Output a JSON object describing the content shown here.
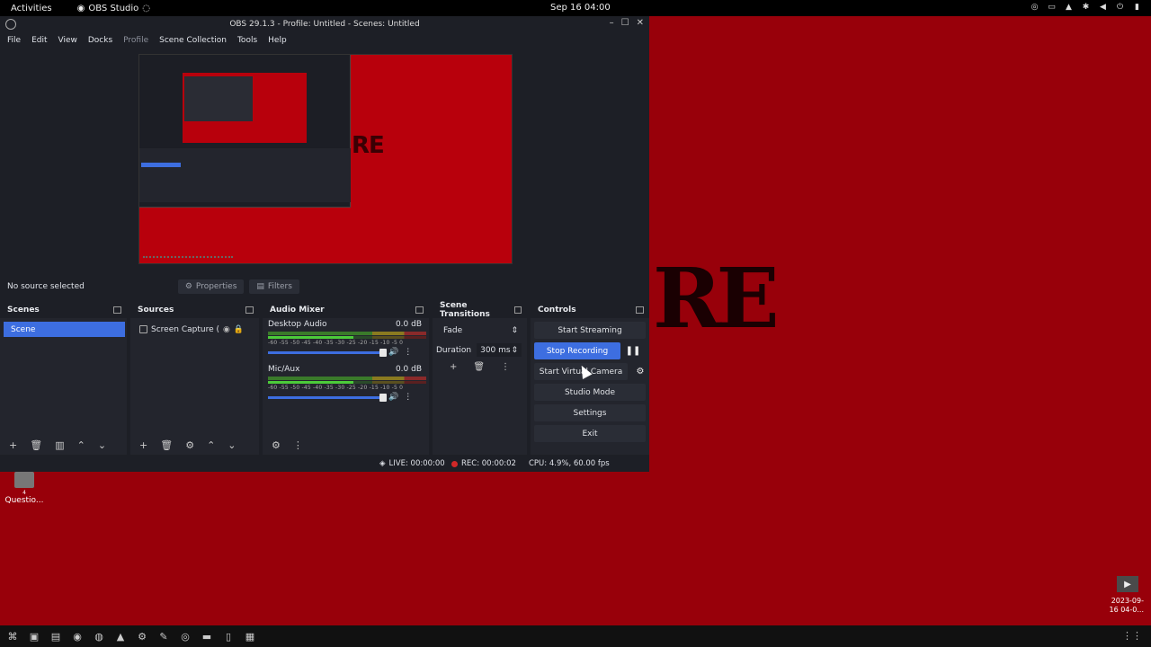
{
  "topbar": {
    "activities": "Activities",
    "app_name": "OBS Studio",
    "clock": "Sep 16  04:00"
  },
  "window": {
    "title": "OBS 29.1.3 - Profile: Untitled - Scenes: Untitled"
  },
  "menu": {
    "file": "File",
    "edit": "Edit",
    "view": "View",
    "docks": "Docks",
    "profile": "Profile",
    "scene_collection": "Scene Collection",
    "tools": "Tools",
    "help": "Help"
  },
  "preview": {
    "overlay_text": "RE"
  },
  "source_bar": {
    "no_source": "No source selected",
    "properties": "Properties",
    "filters": "Filters"
  },
  "scenes": {
    "title": "Scenes",
    "items": [
      "Scene"
    ]
  },
  "sources": {
    "title": "Sources",
    "items": [
      "Screen Capture (Pi"
    ]
  },
  "mixer": {
    "title": "Audio Mixer",
    "ticks": "-60 -55 -50 -45 -40 -35 -30 -25 -20 -15 -10 -5 0",
    "channels": [
      {
        "name": "Desktop Audio",
        "db": "0.0 dB",
        "volume": 1.0
      },
      {
        "name": "Mic/Aux",
        "db": "0.0 dB",
        "volume": 1.0
      }
    ]
  },
  "transitions": {
    "title": "Scene Transitions",
    "selected": "Fade",
    "duration_label": "Duration",
    "duration_value": "300 ms"
  },
  "controls": {
    "title": "Controls",
    "start_streaming": "Start Streaming",
    "stop_recording": "Stop Recording",
    "start_virtual_camera": "Start Virtual Camera",
    "studio_mode": "Studio Mode",
    "settings": "Settings",
    "exit": "Exit"
  },
  "status": {
    "live": "LIVE: 00:00:00",
    "rec": "REC: 00:00:02",
    "cpu": "CPU: 4.9%, 60.00 fps"
  },
  "desktop": {
    "big_text": "RE",
    "icon_label": "Questio...",
    "icon_small": "4",
    "timestamp_line1": "2023-09-",
    "timestamp_line2": "16 04-0..."
  },
  "colors": {
    "accent": "#3d6ee0",
    "desktop_bg": "#98000a",
    "obs_bg": "#1d1f26",
    "rec_dot": "#d02828"
  }
}
